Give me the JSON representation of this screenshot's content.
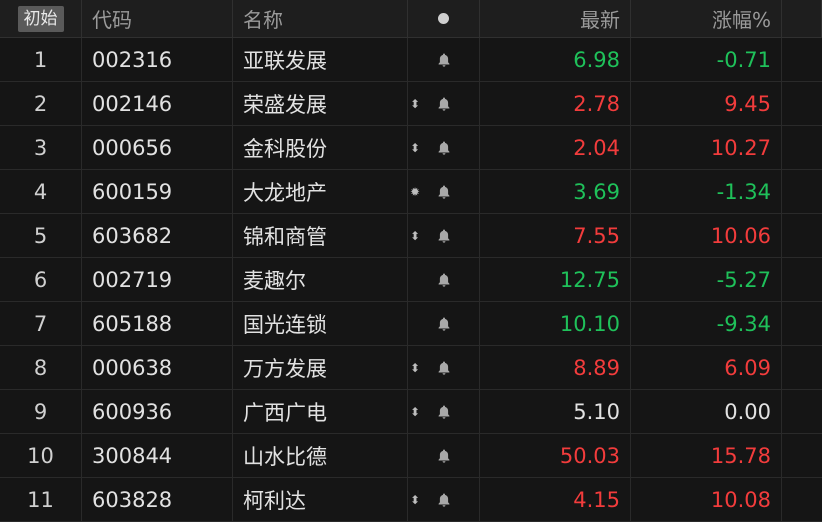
{
  "header": {
    "initial_button": "初始",
    "col_code": "代码",
    "col_name": "名称",
    "col_latest": "最新",
    "col_change": "涨幅%"
  },
  "colors": {
    "up": "#f23c3c",
    "down": "#1fc15a",
    "flat": "#e2e2e2"
  },
  "rows": [
    {
      "idx": "1",
      "code": "002316",
      "name": "亚联发展",
      "mark": "",
      "price": "6.98",
      "change": "-0.71",
      "dir": "down"
    },
    {
      "idx": "2",
      "code": "002146",
      "name": "荣盛发展",
      "mark": "⬍",
      "price": "2.78",
      "change": "9.45",
      "dir": "up"
    },
    {
      "idx": "3",
      "code": "000656",
      "name": "金科股份",
      "mark": "⬍",
      "price": "2.04",
      "change": "10.27",
      "dir": "up"
    },
    {
      "idx": "4",
      "code": "600159",
      "name": "大龙地产",
      "mark": "✹",
      "price": "3.69",
      "change": "-1.34",
      "dir": "down"
    },
    {
      "idx": "5",
      "code": "603682",
      "name": "锦和商管",
      "mark": "⬍",
      "price": "7.55",
      "change": "10.06",
      "dir": "up"
    },
    {
      "idx": "6",
      "code": "002719",
      "name": "麦趣尔",
      "mark": "",
      "price": "12.75",
      "change": "-5.27",
      "dir": "down"
    },
    {
      "idx": "7",
      "code": "605188",
      "name": "国光连锁",
      "mark": "",
      "price": "10.10",
      "change": "-9.34",
      "dir": "down"
    },
    {
      "idx": "8",
      "code": "000638",
      "name": "万方发展",
      "mark": "⬍",
      "price": "8.89",
      "change": "6.09",
      "dir": "up"
    },
    {
      "idx": "9",
      "code": "600936",
      "name": "广西广电",
      "mark": "⬍",
      "price": "5.10",
      "change": "0.00",
      "dir": "flat"
    },
    {
      "idx": "10",
      "code": "300844",
      "name": "山水比德",
      "mark": "",
      "price": "50.03",
      "change": "15.78",
      "dir": "up"
    },
    {
      "idx": "11",
      "code": "603828",
      "name": "柯利达",
      "mark": "⬍",
      "price": "4.15",
      "change": "10.08",
      "dir": "up"
    }
  ]
}
